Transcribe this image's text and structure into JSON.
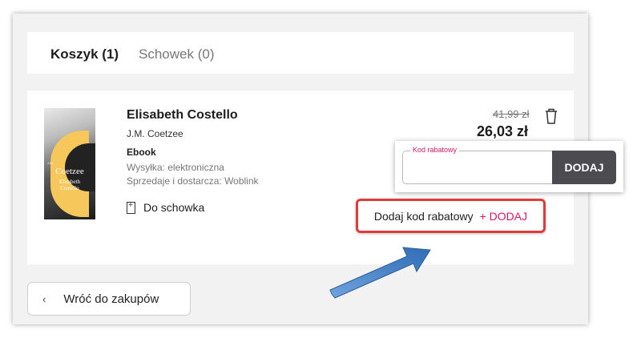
{
  "tabs": {
    "cart": "Koszyk (1)",
    "wishlist": "Schowek (0)"
  },
  "item": {
    "title": "Elisabeth Costello",
    "author": "J.M. Coetzee",
    "format": "Ebook",
    "shipping": "Wysyłka: elektroniczna",
    "seller": "Sprzedaje i dostarcza: Woblink",
    "save_label": "Do schowka",
    "old_price": "41,99 zł",
    "new_price": "26,03 zł",
    "cover": {
      "author": "Coetzee",
      "title_line1": "Elisabeth",
      "title_line2": "Costello",
      "initials": "J.M."
    }
  },
  "promo": {
    "label": "Dodaj kod rabatowy",
    "add_label": "+ DODAJ"
  },
  "code_popup": {
    "field_label": "Kod rabatowy",
    "value": "",
    "button_label": "DODAJ"
  },
  "back_label": "Wróć do zakupów",
  "colors": {
    "accent": "#d4176b",
    "highlight": "#e03b3b",
    "button_dark": "#4b4b50",
    "arrow": "#2f6db5"
  }
}
